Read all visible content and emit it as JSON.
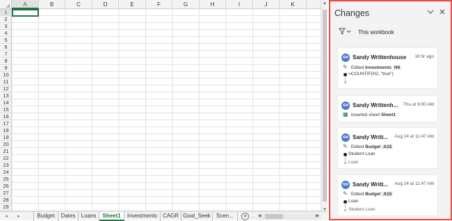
{
  "sheet": {
    "columns": [
      "A",
      "B",
      "C",
      "D",
      "E",
      "F",
      "G",
      "H",
      "I",
      "J",
      "K"
    ],
    "rows": [
      "1",
      "2",
      "3",
      "4",
      "5",
      "6",
      "7",
      "8",
      "9",
      "10",
      "11",
      "12",
      "13",
      "14",
      "15",
      "16",
      "17",
      "18",
      "19",
      "20",
      "21",
      "22",
      "23",
      "24",
      "25",
      "26",
      "27",
      "28",
      "29"
    ],
    "active_cell": "A1"
  },
  "tabs": {
    "nav_prev": "◂",
    "nav_next": "▸",
    "items": [
      "Budget",
      "Dates",
      "Loans",
      "Sheet1",
      "Investments",
      "CAGR",
      "Goal_Seek",
      "Scen..."
    ],
    "active": "Sheet1",
    "more": "...",
    "add": "+"
  },
  "pane": {
    "title": "Changes",
    "collapse_icon": "chevron-down-icon",
    "close_icon": "close-icon",
    "filter_icon": "filter-icon",
    "filter_label": "This workbook",
    "accent_color": "#e8473b",
    "cards": [
      {
        "initials": "SW",
        "user": "Sandy Writtenhouse",
        "time": "18 hr ago",
        "verb": "Edited",
        "target": "Investments",
        "cell": "H4",
        "new_value": "=COUNTIF(H2, \"true\")",
        "old_value": ""
      },
      {
        "initials": "SW",
        "user": "Sandy Writtenh...",
        "time": "Thu at 9:00 AM",
        "verb": "Inserted sheet",
        "target": "Sheet1"
      },
      {
        "initials": "SW",
        "user": "Sandy Writt...",
        "time": "Aug 24 at 11:47 AM",
        "verb": "Edited",
        "target": "Budget",
        "cell": "A15",
        "new_value": "Student Loan",
        "old_value": "Loan"
      },
      {
        "initials": "SW",
        "user": "Sandy Writt...",
        "time": "Aug 24 at 11:47 AM",
        "verb": "Edited",
        "target": "Budget",
        "cell": "A15",
        "new_value": "Loan",
        "old_value": "Student Loan"
      }
    ]
  }
}
